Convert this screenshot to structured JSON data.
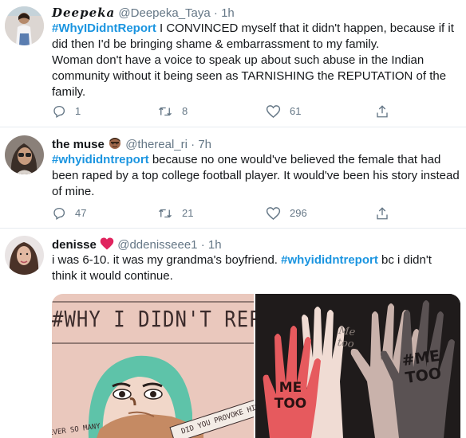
{
  "tweets": [
    {
      "name": "Deepeka",
      "handle": "@Deepeka_Taya",
      "separator": "·",
      "time": "1h",
      "hashtag": "#WhyIDidntReport",
      "text": " I CONVINCED myself that it didn't happen, because if it did then I'd be bringing shame & embarrassment to my family.",
      "text2": "Woman don't have a voice to speak up about such abuse in the Indian community without it being seen as TARNISHING the REPUTATION of the family.",
      "replies": "1",
      "retweets": "8",
      "likes": "61"
    },
    {
      "name": "the muse",
      "handle": "@thereal_ri",
      "separator": "·",
      "time": "7h",
      "hashtag": "#whyididntreport",
      "text": " because no one would've believed the female that had been raped by a top college football player. It would've been his story instead of mine.",
      "replies": "47",
      "retweets": "21",
      "likes": "296"
    },
    {
      "name": "denisse",
      "handle": "@ddenisseee1",
      "separator": "·",
      "time": "1h",
      "text_before": "i was 6-10. it was my grandma's boyfriend. ",
      "hashtag": "#whyididntreport",
      "text_after": " bc i didn't think it would continue.",
      "media": {
        "left_title": "#WHY I DIDN'T REPORT",
        "left_side_text": "DID YOU PROVOKE HIM?",
        "left_bottom_text": "EVER SO MANY",
        "right_hand_texts": [
          "ME TOO",
          "Me too",
          "#ME TOO"
        ]
      }
    }
  ],
  "colors": {
    "link": "#1b95e0",
    "muted": "#657786",
    "divider": "#e6ecf0",
    "heart": "#e0245e"
  },
  "icons": [
    "reply-icon",
    "retweet-icon",
    "like-icon",
    "share-icon",
    "man-emoji-icon",
    "red-heart-icon"
  ]
}
